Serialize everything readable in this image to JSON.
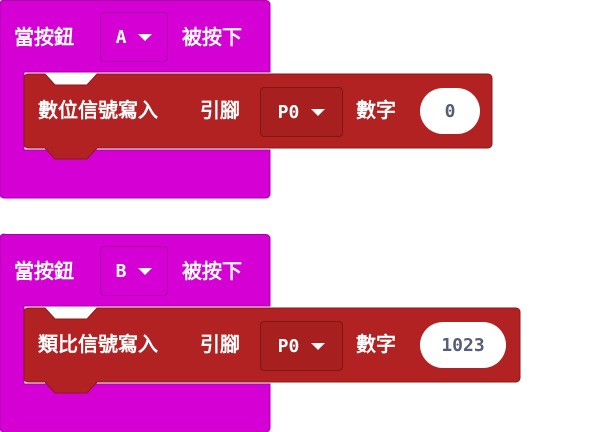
{
  "colors": {
    "event": "#d400d4",
    "pins": "#b22222",
    "text": "#ffffff",
    "number_text": "#575e75"
  },
  "blocks": [
    {
      "event_prefix": "當按鈕",
      "button": "A",
      "event_suffix": "被按下",
      "statement": {
        "label": "數位信號寫入",
        "pin_label": "引腳",
        "pin": "P0",
        "value_label": "數字",
        "value": "0"
      }
    },
    {
      "event_prefix": "當按鈕",
      "button": "B",
      "event_suffix": "被按下",
      "statement": {
        "label": "類比信號寫入",
        "pin_label": "引腳",
        "pin": "P0",
        "value_label": "數字",
        "value": "1023"
      }
    }
  ]
}
